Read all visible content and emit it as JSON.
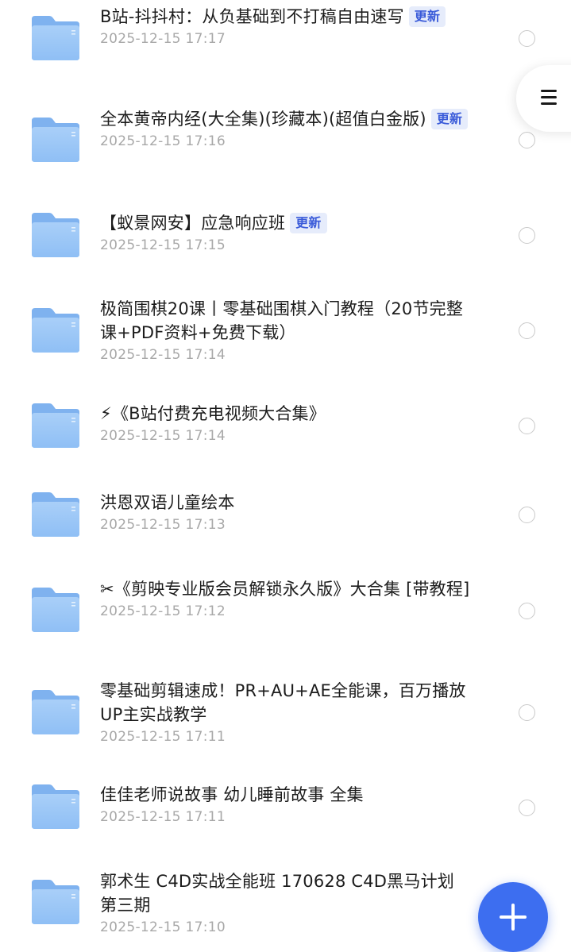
{
  "colors": {
    "folder_back": "#7fb2ef",
    "folder_front": "#a9cff8",
    "badge_text": "#3a5bd9",
    "badge_bg": "#e6ecfb",
    "fab": "#3d6ef0"
  },
  "icons": {
    "folder": "folder-icon",
    "menu": "menu-icon",
    "add": "plus-icon",
    "select": "radio-unchecked-icon"
  },
  "items": [
    {
      "title": "B站-抖抖村：从负基础到不打稿自由速写",
      "badge": "更新",
      "date": "2025-12-15 17:17"
    },
    {
      "title": "全本黄帝内经(大全集)(珍藏本)(超值白金版)",
      "badge": "更新",
      "date": "2025-12-15 17:16"
    },
    {
      "title": "【蚁景网安】应急响应班",
      "badge": "更新",
      "date": "2025-12-15 17:15"
    },
    {
      "title": "极简围棋20课丨零基础围棋入门教程（20节完整课+PDF资料+免费下载）",
      "badge": "",
      "date": "2025-12-15 17:14"
    },
    {
      "title": "⚡《B站付费充电视频大合集》",
      "badge": "",
      "date": "2025-12-15 17:14"
    },
    {
      "title": "洪恩双语儿童绘本",
      "badge": "",
      "date": "2025-12-15 17:13"
    },
    {
      "title": "✂《剪映专业版会员解锁永久版》大合集 [带教程]",
      "badge": "",
      "date": "2025-12-15 17:12"
    },
    {
      "title": "零基础剪辑速成！PR+AU+AE全能课，百万播放UP主实战教学",
      "badge": "",
      "date": "2025-12-15 17:11"
    },
    {
      "title": "佳佳老师说故事 幼儿睡前故事 全集",
      "badge": "",
      "date": "2025-12-15 17:11"
    },
    {
      "title": "郭术生 C4D实战全能班 170628 C4D黑马计划 第三期",
      "badge": "",
      "date": "2025-12-15 17:10"
    }
  ]
}
